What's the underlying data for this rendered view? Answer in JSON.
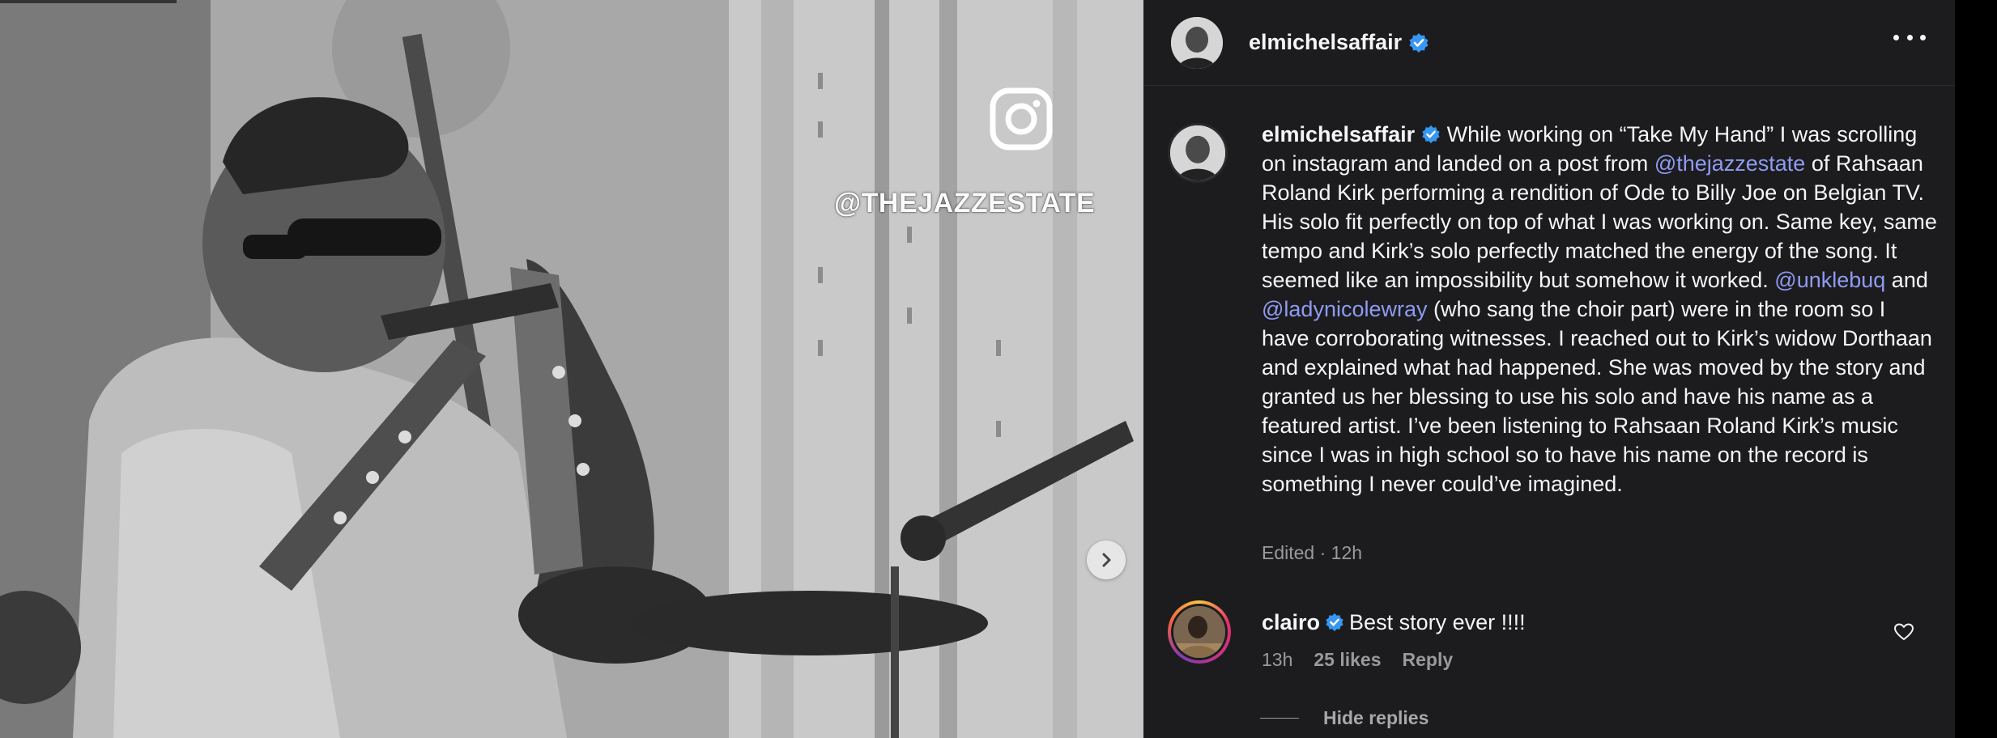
{
  "media": {
    "watermark": "@THEJAZZESTATE",
    "icons": {
      "instagram": "instagram-logo-icon",
      "next": "chevron-right-icon"
    }
  },
  "header": {
    "username": "elmichelsaffair",
    "icons": {
      "verified": "verified-badge-icon",
      "more": "more-options-icon"
    }
  },
  "caption": {
    "username": "elmichelsaffair",
    "text_1": " While working on “Take My Hand” I was scrolling on instagram and landed on a post from ",
    "mention_1": "@thejazzestate",
    "text_2": " of Rahsaan Roland Kirk performing a rendition of Ode to Billy Joe on Belgian TV. His solo fit perfectly on top of what I was working on. Same key, same tempo and Kirk’s solo perfectly matched the energy of the song. It seemed like an impossibility but somehow it worked. ",
    "mention_2": "@unklebuq",
    "text_3": " and ",
    "mention_3": "@ladynicolewray",
    "text_4": " (who sang the choir part) were in the room so I have corroborating witnesses. I reached out to Kirk’s widow Dorthaan and explained what had happened. She was moved by the story and granted us her blessing to use his solo and have his name as a featured artist. I’ve been listening to Rahsaan Roland Kirk’s music since I was in high school so to have his name on the record is something I never could’ve imagined.",
    "meta": "Edited · 12h"
  },
  "comment": {
    "username": "clairo",
    "text": "Best story ever !!!!",
    "time": "13h",
    "likes": "25 likes",
    "reply": "Reply",
    "icons": {
      "like": "heart-icon"
    }
  },
  "replies": {
    "toggle_label": "Hide replies"
  },
  "colors": {
    "panel_bg": "#1c1c1e",
    "mention": "#8f9bf2",
    "verified": "#3897f0",
    "muted": "#9a9a9a"
  }
}
